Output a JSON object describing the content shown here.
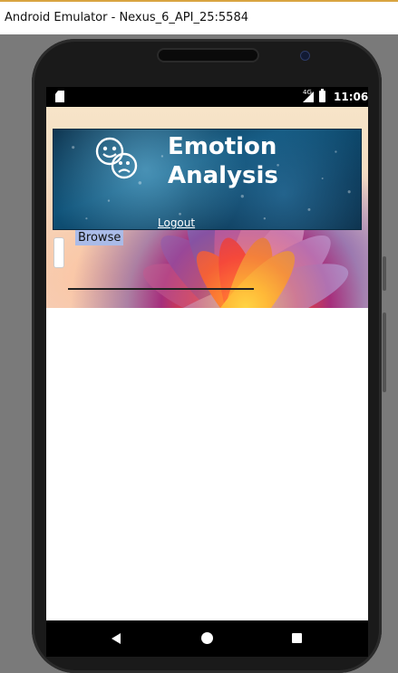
{
  "window": {
    "title": "Android Emulator - Nexus_6_API_25:5584"
  },
  "status_bar": {
    "time": "11:06",
    "network": "4G",
    "icons": [
      "sd-card-icon",
      "signal-icon",
      "battery-icon"
    ]
  },
  "app": {
    "title_line1": "Emotion",
    "title_line2": "Analysis",
    "logout_label": "Logout",
    "browse_label": "Browse",
    "logo_icon": "emotion-faces-icon"
  },
  "nav_bar": {
    "icons": [
      "back-icon",
      "home-icon",
      "recents-icon"
    ]
  },
  "colors": {
    "banner": "#0f5278",
    "browse_highlight": "#aabbe8",
    "device": "#1a1a1a"
  }
}
